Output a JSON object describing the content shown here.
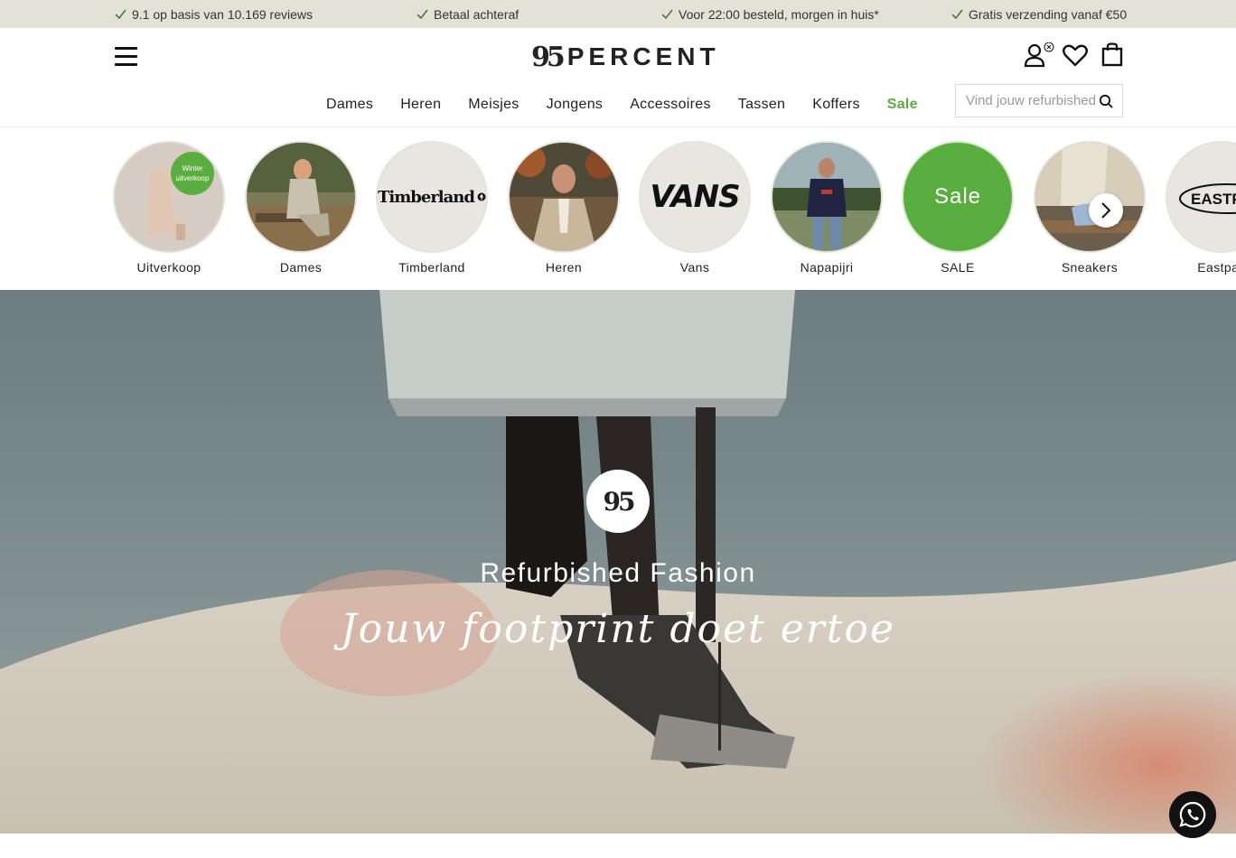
{
  "usps": [
    {
      "text": "9.1 op basis van 10.169 reviews",
      "icon": "check-icon"
    },
    {
      "text": "Betaal achteraf",
      "icon": "check-icon"
    },
    {
      "text": "Voor 22:00 besteld, morgen in huis*",
      "icon": "check-icon"
    },
    {
      "text": "Gratis verzending vanaf €50",
      "icon": "check-icon"
    }
  ],
  "header": {
    "logo_number": "95",
    "logo_word": "PERCENT",
    "icons": [
      "menu-icon",
      "account-icon",
      "wishlist-heart-icon",
      "shopping-bag-icon"
    ]
  },
  "nav": {
    "items": [
      "Dames",
      "Heren",
      "Meisjes",
      "Jongens",
      "Accessoires",
      "Tassen",
      "Koffers",
      "Sale"
    ]
  },
  "search": {
    "placeholder": "Vind jouw refurbished item"
  },
  "categories": [
    {
      "label": "Uitverkoop",
      "badge": "Winter uitverkoop"
    },
    {
      "label": "Dames"
    },
    {
      "label": "Timberland",
      "logo_text": "Timberland"
    },
    {
      "label": "Heren"
    },
    {
      "label": "Vans",
      "logo_text": "VANS"
    },
    {
      "label": "Napapijri"
    },
    {
      "label": "SALE",
      "circle_text": "Sale"
    },
    {
      "label": "Sneakers"
    },
    {
      "label": "Eastpak",
      "logo_text": "EASTPAK"
    }
  ],
  "hero": {
    "badge": "95",
    "title": "Refurbished Fashion",
    "subtitle": "Jouw footprint doet ertoe"
  },
  "colors": {
    "usp_bar": "#e4e1d6",
    "accent_green": "#5aae3f",
    "check_green": "#4b7a3c"
  }
}
